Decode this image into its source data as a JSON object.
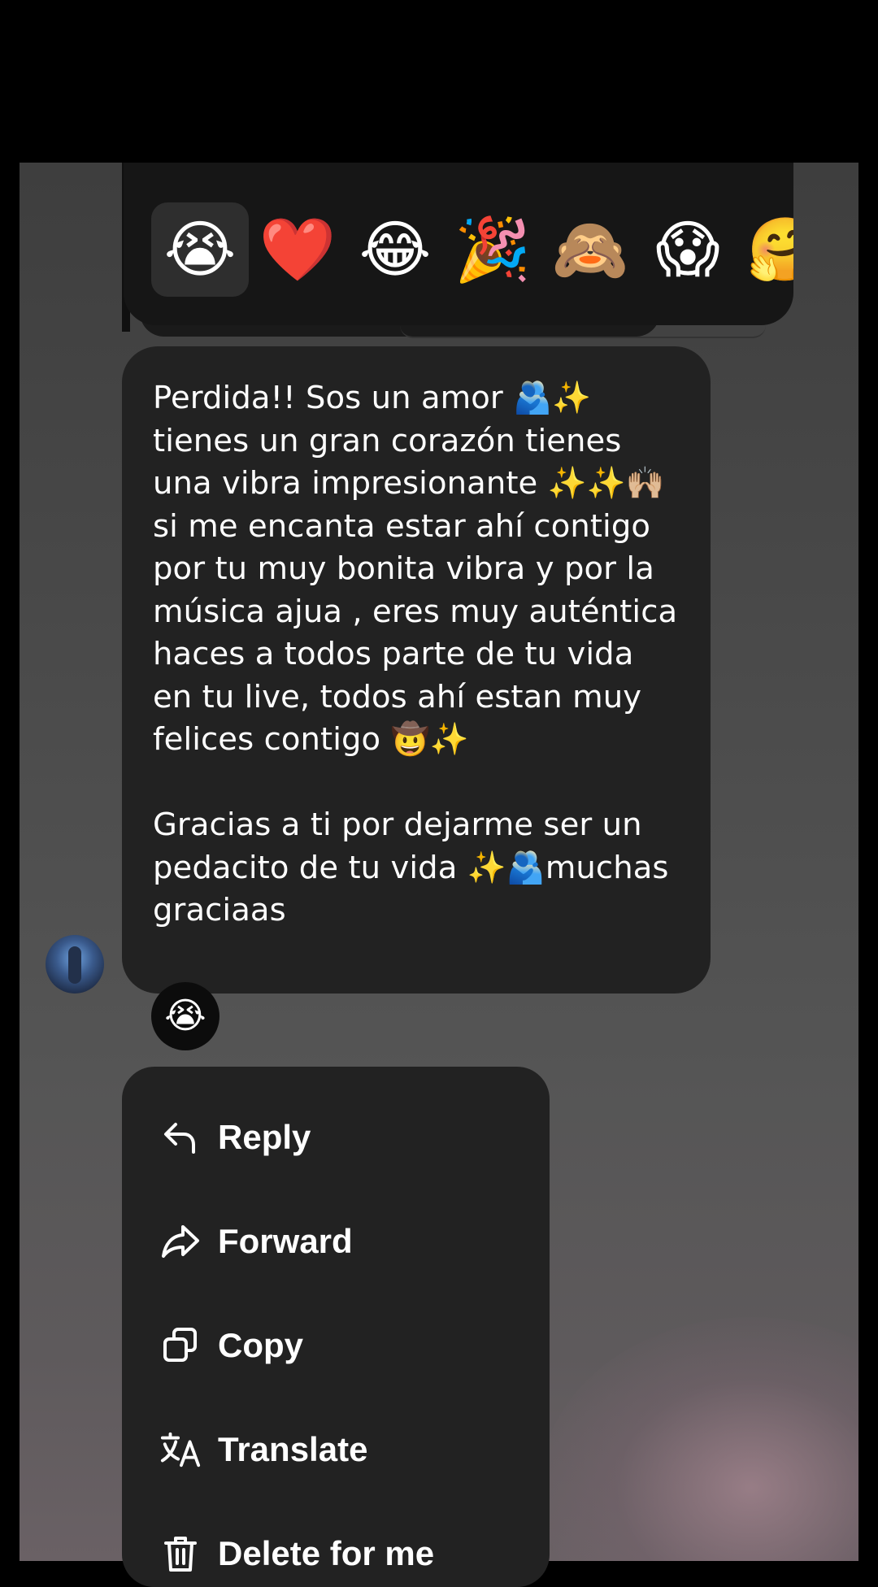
{
  "reactions": [
    "😭",
    "❤️",
    "😂",
    "🎉",
    "🙈",
    "😱",
    "🤗"
  ],
  "selected_reaction_index": 0,
  "message": {
    "text": "Perdida!! Sos un amor 🫂✨\ntienes un gran corazón tienes una vibra impresionante ✨✨🙌🏼 si me encanta estar ahí contigo por tu muy bonita vibra y por la música ajua , eres muy auténtica haces a todos parte de tu vida en tu live, todos ahí estan muy felices contigo 🤠✨\n\nGracias a ti por dejarme ser un pedacito de tu vida ✨🫂muchas graciaas"
  },
  "message_reaction": "😭",
  "menu": {
    "reply": "Reply",
    "forward": "Forward",
    "copy": "Copy",
    "translate": "Translate",
    "delete": "Delete for me"
  },
  "icons": {
    "reply": "reply-arrow-icon",
    "forward": "forward-arrow-icon",
    "copy": "copy-icon",
    "translate": "translate-icon",
    "delete": "trash-icon"
  },
  "colors": {
    "bubble": "#222222",
    "menu": "#222222",
    "text": "#ffffff"
  }
}
